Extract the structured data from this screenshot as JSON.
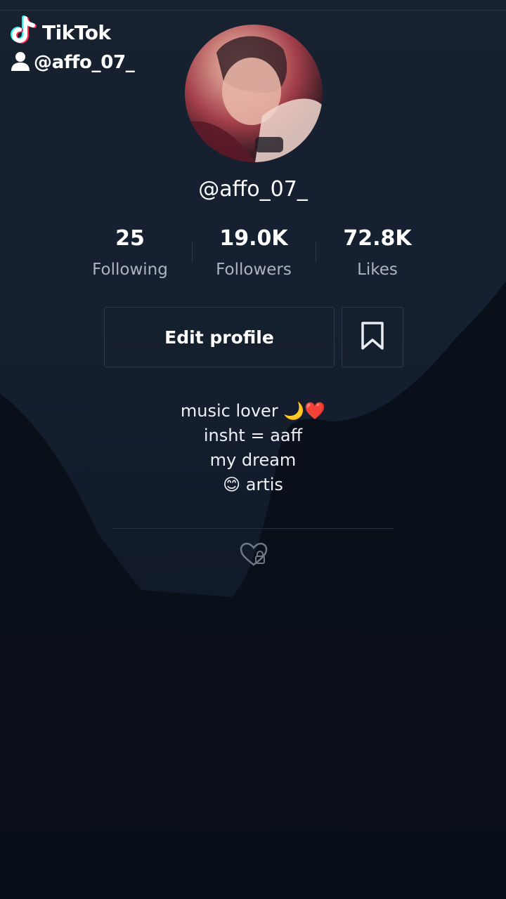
{
  "watermark": {
    "brand": "TikTok",
    "handle": "@affo_07_"
  },
  "profile": {
    "username": "@affo_07_",
    "stats": [
      {
        "value": "25",
        "label": "Following"
      },
      {
        "value": "19.0K",
        "label": "Followers"
      },
      {
        "value": "72.8K",
        "label": "Likes"
      }
    ],
    "edit_label": "Edit profile",
    "bio": [
      "music lover 🌙❤️",
      "insht = aaff",
      "my dream",
      "😊 artis"
    ]
  },
  "icons": {
    "logo": "tiktok-logo",
    "user": "user-icon",
    "bookmark": "bookmark-icon",
    "liked": "heart-lock-icon"
  },
  "colors": {
    "background": "#0d1522",
    "text": "#ffffff",
    "muted": "#aeb4bd",
    "border": "#2e3a4a"
  }
}
